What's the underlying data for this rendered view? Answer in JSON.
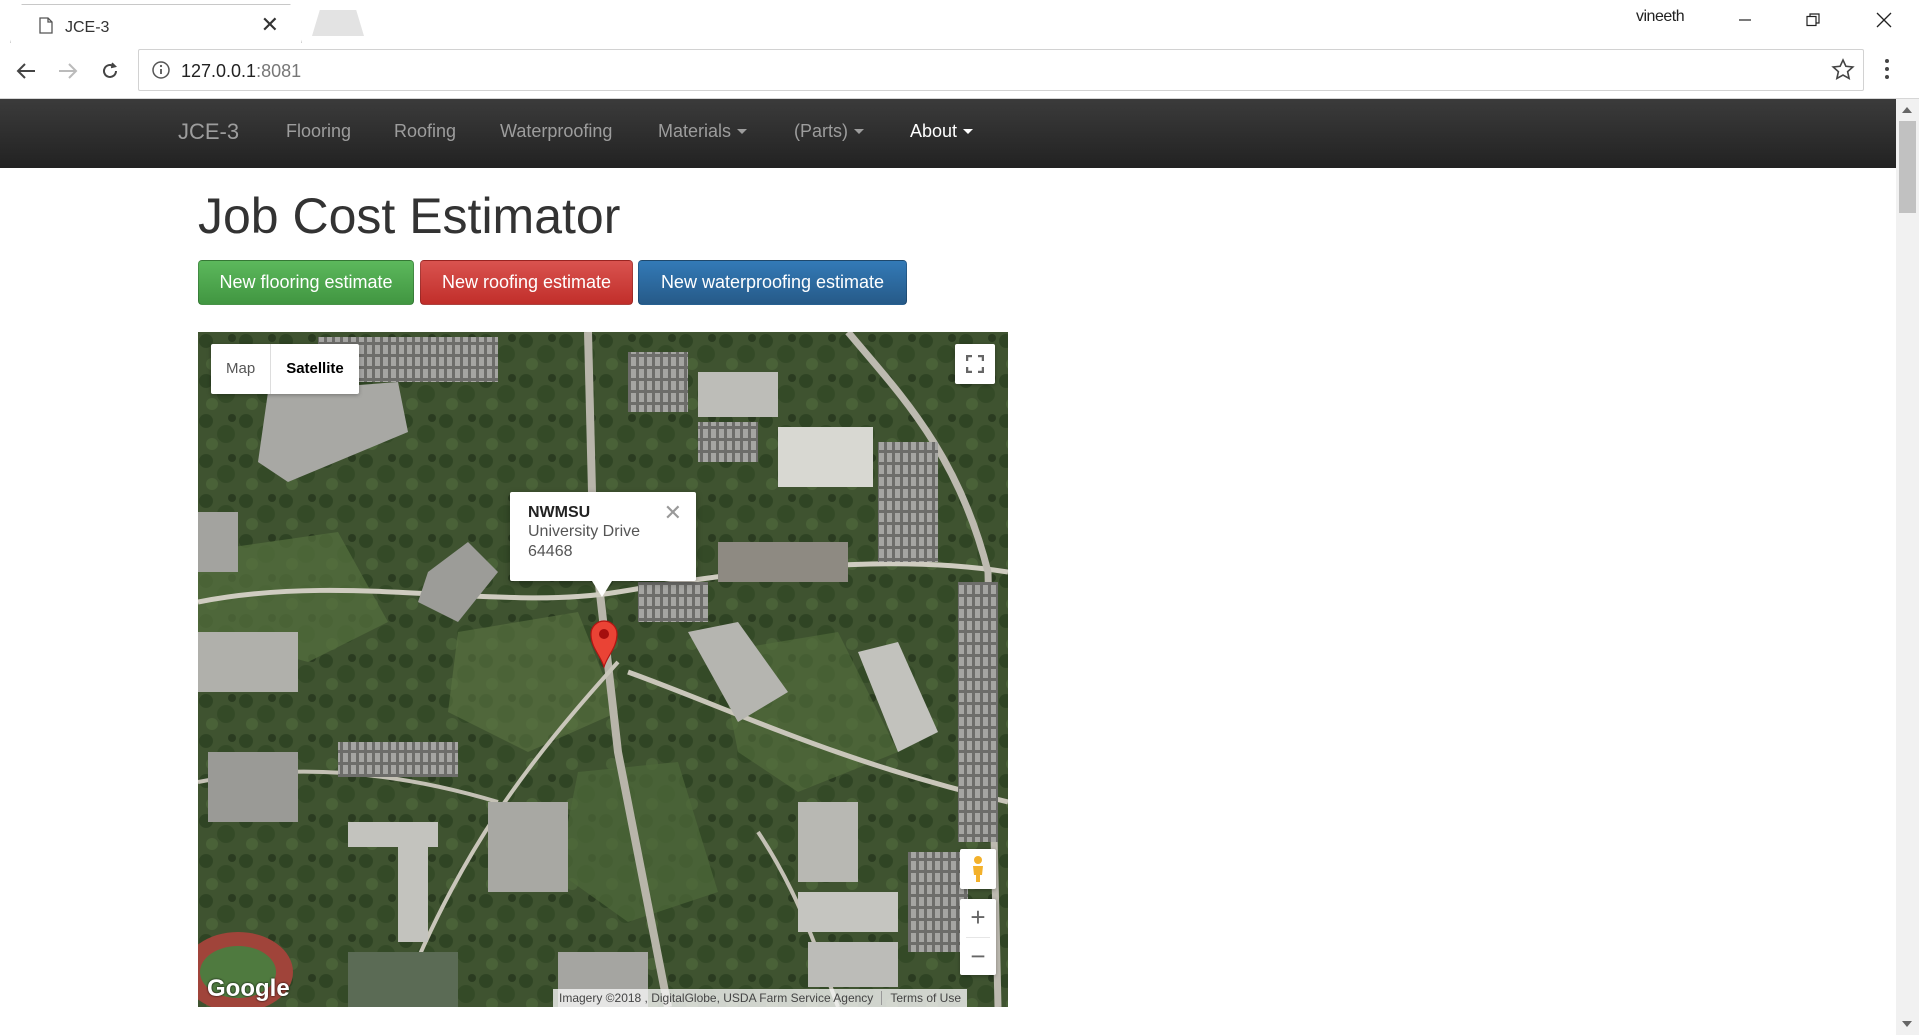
{
  "browser": {
    "tab_title": "JCE-3",
    "profile_name": "vineeth",
    "url_host": "127.0.0.1",
    "url_port": ":8081"
  },
  "navbar": {
    "brand": "JCE-3",
    "items": [
      {
        "label": "Flooring"
      },
      {
        "label": "Roofing"
      },
      {
        "label": "Waterproofing"
      },
      {
        "label": "Materials"
      },
      {
        "label": "(Parts)"
      },
      {
        "label": "About"
      }
    ]
  },
  "page": {
    "title": "Job Cost Estimator",
    "buttons": {
      "flooring": "New flooring estimate",
      "roofing": "New roofing estimate",
      "waterproofing": "New waterproofing estimate"
    }
  },
  "map": {
    "type_map": "Map",
    "type_satellite": "Satellite",
    "selected_type": "Satellite",
    "info": {
      "title": "NWMSU",
      "line1": "University Drive",
      "line2": "64468"
    },
    "zoom_in": "+",
    "zoom_out": "−",
    "logo": "Google",
    "attribution": "Imagery ©2018 , DigitalGlobe, USDA Farm Service Agency",
    "terms": "Terms of Use"
  },
  "colors": {
    "navbar_bg": "#222222",
    "btn_success": "#5cb85c",
    "btn_danger": "#d9534f",
    "btn_primary": "#337ab7",
    "marker": "#ea4335"
  },
  "icons": [
    "page-icon",
    "back-icon",
    "forward-icon",
    "reload-icon",
    "info-icon",
    "star-icon",
    "menu-icon",
    "fullscreen-icon",
    "pegman-icon",
    "marker-icon",
    "close-icon"
  ]
}
